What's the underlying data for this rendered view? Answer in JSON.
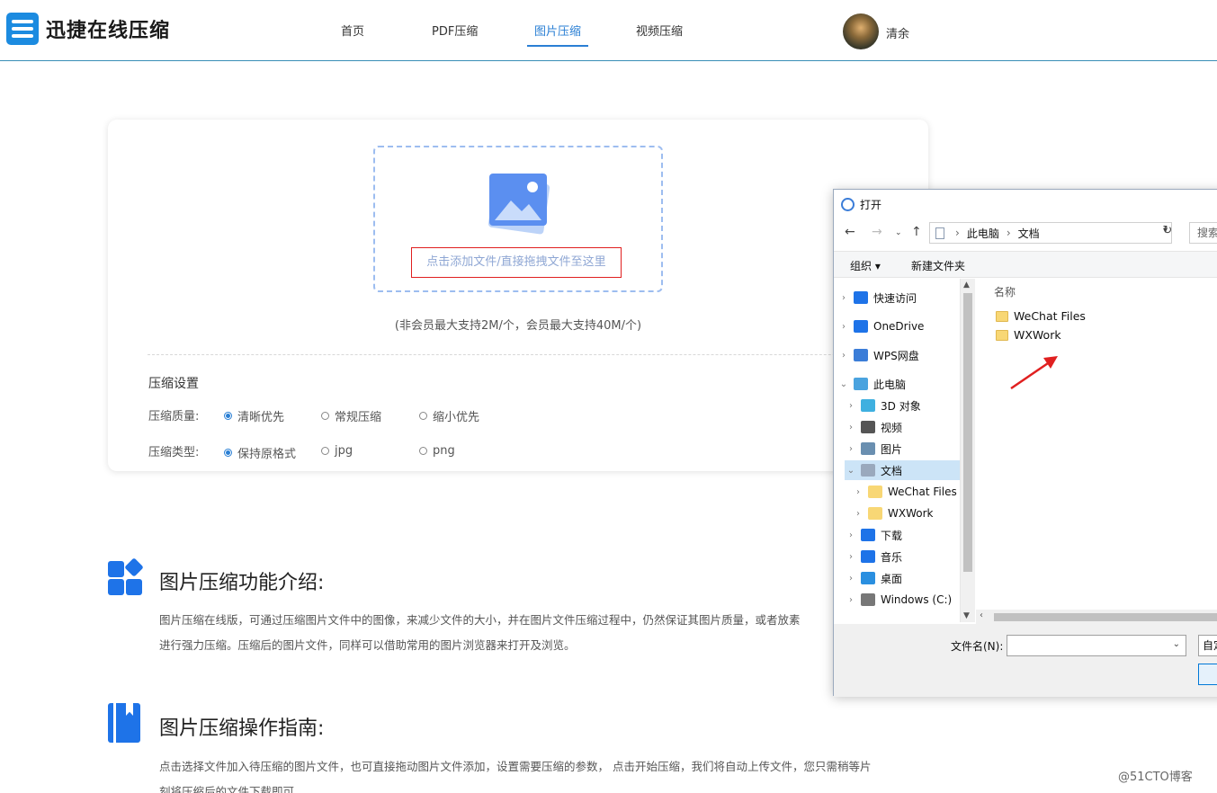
{
  "brand": {
    "name": "迅捷在线压缩"
  },
  "nav": {
    "items": [
      {
        "label": "首页"
      },
      {
        "label": "PDF压缩"
      },
      {
        "label": "图片压缩",
        "active": true
      },
      {
        "label": "视频压缩"
      }
    ]
  },
  "user": {
    "name": "清余"
  },
  "upload": {
    "drop_text": "点击添加文件/直接拖拽文件至这里",
    "limit_note": "(非会员最大支持2M/个，会员最大支持40M/个)"
  },
  "settings": {
    "title": "压缩设置",
    "quality_label": "压缩质量:",
    "quality_options": [
      "清晰优先",
      "常规压缩",
      "缩小优先"
    ],
    "quality_selected": "清晰优先",
    "type_label": "压缩类型:",
    "type_options": [
      "保持原格式",
      "jpg",
      "png"
    ],
    "type_selected": "保持原格式"
  },
  "sections": {
    "intro_title": "图片压缩功能介绍:",
    "intro_line1": "图片压缩在线版，可通过压缩图片文件中的图像，来减少文件的大小，并在图片文件压缩过程中，仍然保证其图片质量，或者放素",
    "intro_line2": "进行强力压缩。压缩后的图片文件，同样可以借助常用的图片浏览器来打开及浏览。",
    "guide_title": "图片压缩操作指南:",
    "guide_line1": "点击选择文件加入待压缩的图片文件，也可直接拖动图片文件添加，设置需要压缩的参数， 点击开始压缩，我们将自动上传文件，您只需稍等片",
    "guide_line2": "刻将压缩后的文件下载即可。"
  },
  "watermark": "@51CTO博客",
  "dialog": {
    "title": "打开",
    "path": [
      "此电脑",
      "文档"
    ],
    "search_placeholder": "搜索",
    "organize": "组织 ▾",
    "new_folder": "新建文件夹",
    "column_name": "名称",
    "tree": [
      {
        "label": "快速访问",
        "icon": "star-icon",
        "color": "#1e73e8",
        "depth": 0
      },
      {
        "label": "OneDrive",
        "icon": "cloud-icon",
        "color": "#1e73e8",
        "depth": 0
      },
      {
        "label": "WPS网盘",
        "icon": "cloud-outline-icon",
        "color": "#3b7dd8",
        "depth": 0
      },
      {
        "label": "此电脑",
        "icon": "computer-icon",
        "color": "#4aa3df",
        "depth": 0,
        "expanded": true
      },
      {
        "label": "3D 对象",
        "icon": "cube-icon",
        "color": "#3fb0e0",
        "depth": 1
      },
      {
        "label": "视频",
        "icon": "film-icon",
        "color": "#555555",
        "depth": 1
      },
      {
        "label": "图片",
        "icon": "picture-icon",
        "color": "#6a8fb0",
        "depth": 1
      },
      {
        "label": "文档",
        "icon": "document-icon",
        "color": "#9aa9bd",
        "depth": 1,
        "selected": true,
        "expanded": true
      },
      {
        "label": "WeChat Files",
        "icon": "folder-icon",
        "color": "#f8d775",
        "depth": 2
      },
      {
        "label": "WXWork",
        "icon": "folder-icon",
        "color": "#f8d775",
        "depth": 2
      },
      {
        "label": "下载",
        "icon": "download-icon",
        "color": "#1e73e8",
        "depth": 1
      },
      {
        "label": "音乐",
        "icon": "music-icon",
        "color": "#1e73e8",
        "depth": 1
      },
      {
        "label": "桌面",
        "icon": "desktop-icon",
        "color": "#2a8fe0",
        "depth": 1
      },
      {
        "label": "Windows (C:)",
        "icon": "drive-icon",
        "color": "#777777",
        "depth": 1
      }
    ],
    "files": [
      {
        "name": "WeChat Files"
      },
      {
        "name": "WXWork"
      }
    ],
    "filename_label": "文件名(N):",
    "filename_value": "",
    "filter_text": "自定"
  }
}
